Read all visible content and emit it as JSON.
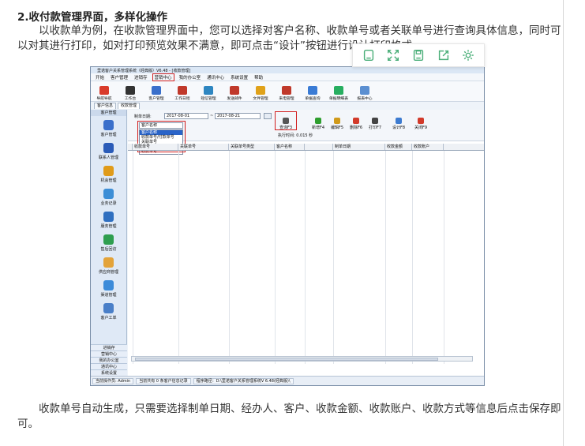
{
  "heading": "2.收付款管理界面，多样化操作",
  "intro_paragraph": "以收款单为例，在收款管理界面中，您可以选择对客户名称、收款单号或者关联单号进行查询具体信息，同时可以对其进行打印，如对打印预览效果不满意，即可点击“设计”按钮进行设计打印格式。",
  "closing_paragraph": "收款单号自动生成，只需要选择制单日期、经办人、客户、收款金额、收款账户、收款方式等信息后点击保存即可。",
  "float_toolbar": {
    "icons": [
      "copy-icon",
      "expand-icon",
      "save-icon",
      "share-icon",
      "settings-icon"
    ]
  },
  "app": {
    "title": "里诺客户关系管理系统（经典版）V6.48 - [收款管理]",
    "menu": [
      "开始",
      "客户管理",
      "进销存",
      "营销中心",
      "我的办公室",
      "通讯中心",
      "系统设置",
      "帮助"
    ],
    "menu_active_index": 3,
    "toolbar": [
      {
        "label": "导航导航",
        "color": "#d93b2b"
      },
      {
        "label": "工作台",
        "color": "#333333"
      },
      {
        "label": "客户管理",
        "color": "#3a6fcb"
      },
      {
        "label": "工作日程",
        "color": "#c0392b"
      },
      {
        "label": "短信管理",
        "color": "#2e86c1"
      },
      {
        "label": "发送邮件",
        "color": "#c0392b"
      },
      {
        "label": "文件管理",
        "color": "#e0a21a"
      },
      {
        "label": "来电管理",
        "color": "#c0392b"
      },
      {
        "label": "单据查询",
        "color": "#3a7bd5"
      },
      {
        "label": "单据明细表",
        "color": "#27ae60"
      },
      {
        "label": "报表中心",
        "color": "#5b8fd1"
      }
    ],
    "tabs": [
      "客户信息",
      "收款管理"
    ],
    "sidebar_head": "客户管理",
    "sidebar_items": [
      {
        "label": "客户管理",
        "color": "#3a6fcb"
      },
      {
        "label": "联系人管理",
        "color": "#2a5bb8"
      },
      {
        "label": "机会管理",
        "color": "#e09b1a"
      },
      {
        "label": "业务记录",
        "color": "#3d8ed6"
      },
      {
        "label": "服务管理",
        "color": "#2f6fc0"
      },
      {
        "label": "售后回访",
        "color": "#2e9e4f"
      },
      {
        "label": "供应商管理",
        "color": "#e3a33a"
      },
      {
        "label": "渠道管理",
        "color": "#3c8bd9"
      },
      {
        "label": "客户工单",
        "color": "#4a7fc8"
      }
    ],
    "sidebar_bottom": [
      "进销存",
      "营销中心",
      "我的办公室",
      "通讯中心",
      "系统设置"
    ],
    "filter": {
      "date_label": "制单日期:",
      "date_from": "2017-08-01",
      "date_sep": "~",
      "date_to": "2017-08-21",
      "query_select_value": "客户名称",
      "dropdown_options": [
        "客户名称",
        "收款单号/付款单号",
        "关联单号",
        "备注",
        "收款单号"
      ],
      "exec_time": "执行时间: 0.015 秒",
      "buttons": [
        {
          "label": "查询F3",
          "color": "#555555"
        },
        {
          "label": "新增F4",
          "color": "#2e9e2e"
        },
        {
          "label": "编辑F5",
          "color": "#d09a1a"
        },
        {
          "label": "删除F6",
          "color": "#d23a2a"
        },
        {
          "label": "打印F7",
          "color": "#444444"
        },
        {
          "label": "设计F8",
          "color": "#3c7bd0"
        },
        {
          "label": "关闭F9",
          "color": "#d23a2a"
        }
      ]
    },
    "grid_columns": [
      "",
      "收款单号",
      "关联单号",
      "关联单号类型",
      "客户名称",
      "",
      "制单日期",
      "收款金额",
      "收款账户"
    ],
    "status": [
      "当前操作员: Admin",
      "当前共有 0 条客户信息记录",
      "程序路径：D:\\里诺客户关系管理系统V 6.48(经典版)\\"
    ]
  }
}
